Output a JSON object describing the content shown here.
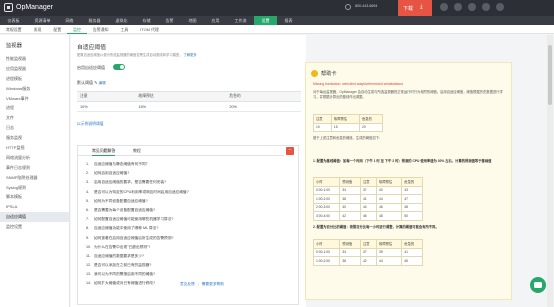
{
  "app": {
    "name": "OpManager"
  },
  "topbar": {
    "phone": "800-443-6694",
    "download_label": "下载",
    "download_icon": "download-arrow-icon"
  },
  "nav_primary": {
    "items": [
      "仪表板",
      "资源清单",
      "网络",
      "服务器",
      "虚拟化",
      "存储",
      "告警",
      "地图",
      "应用",
      "工作流",
      "设置",
      "报表"
    ],
    "active_index": 10
  },
  "nav_secondary": {
    "items": [
      "常规设置",
      "发现",
      "配置",
      "监控",
      "告警通知",
      "工具",
      "ITOM 代理"
    ],
    "active_index": 3
  },
  "sidebar": {
    "title": "监视器",
    "items": [
      "性能监视器",
      "应用监视器",
      "进程模板",
      "Windows服务",
      "VMware事件",
      "进程",
      "文件",
      "日志",
      "服务监视",
      "HTTP监视",
      "网络流量分析",
      "事件日志规则",
      "SNMP陷阱处理器",
      "Syslog规则",
      "脚本模板",
      "IPSLA",
      "自适应阈值",
      "监控设置"
    ],
    "active_index": 16
  },
  "main": {
    "title": "自适应阈值",
    "description": "配置自适应阈值以便为所选监视器的阈值告警生成自动基线和学习模型。",
    "learn_more": "了解更多",
    "enable_label": "启用自适应阈值",
    "enabled": true,
    "threshold_section": "默认阈值",
    "edit_label": "编辑",
    "table": {
      "headers": [
        "注意",
        "故障预估",
        "危急的"
      ],
      "row": [
        "10%",
        "15%",
        "20%"
      ]
    },
    "explain_link": "以示例说明阈值"
  },
  "faq": {
    "tabs": [
      "常见问题解答",
      "教程"
    ],
    "active_tab": 0,
    "questions": [
      "自适应阈值与静态阈值有何不同？",
      "如何启用自适应阈值?",
      "启用自适应阈值的要求。是否需要任何安装?",
      "是否可以为特定的CPU利用率或响应时间启用自适应阈值?",
      "如何为不同设备配置自适应阈值?",
      "是否需要为每个设备配置自适应阈值?",
      "如何配置自适应阈值可能使用哪些机器学习算法?",
      "自适应阈值功能中使用了哪种 ML 算法?",
      "如何查看在启用自适应阈值后所生成的告警预测?",
      "为什么在告警中出现\"已超出预测\"?",
      "自适应阈值的数据要求是多少?",
      "是否可以添加在之前已有的监视器?",
      "我可以为不同的警报启用不同的阈值?",
      "如何扩大阈值或对已有阈值进行修改?"
    ]
  },
  "bottom_links": [
    "意见反馈",
    "需要更多帮助"
  ],
  "help_card": {
    "title": "帮助卡",
    "missing": "Missing translation: webclient.adaptivethreshold.whatisitabout",
    "intro": "对于每台监视器，OpManager 会自动生成与所选监视器的正常运行时行为相符的阈值。启用自适应阈值，阈值根据历史数据进行学习，并根据计算出的基线作出调整。",
    "table1_headers": [
      "注意",
      "故障预估",
      "危急的"
    ],
    "table1_row": [
      "10",
      "15",
      "20"
    ],
    "note": "基于上述注意和危急的阈值，生成的阈值如下：",
    "bullet1": "1. 配置为基线阈值：如每一个时间（下午 1 时 至 下午 2 时）预测的 CPU 使用率值为 30% 左右，计算的预测值等于基础值",
    "table2_headers": [
      "小时",
      "预测值",
      "注意",
      "故障预估",
      "危急的"
    ],
    "table2_rows": [
      [
        "0:00-1:00",
        "34",
        "37",
        "40",
        "43"
      ],
      [
        "1:00-2:00",
        "38",
        "41",
        "44",
        "47"
      ],
      [
        "2:00-3:00",
        "40",
        "44",
        "46",
        "48"
      ],
      [
        "3:00-4:00",
        "42",
        "46",
        "48",
        "50"
      ]
    ],
    "bullet2": "2. 配置为百分比的阈值：按照百分比每一小时进行调整，计算的阈值可能会有所不同。",
    "table3_headers": [
      "小时",
      "预测值",
      "注意",
      "故障预估",
      "危急的"
    ],
    "table3_rows": [
      [
        "0:00-1:00",
        "34",
        "37",
        "39",
        "41"
      ],
      [
        "1:00-2:00",
        "38",
        "42",
        "44",
        "46"
      ]
    ]
  },
  "colors": {
    "accent": "#27a86b",
    "download": "#e65544",
    "help_bg": "#fffbea"
  }
}
